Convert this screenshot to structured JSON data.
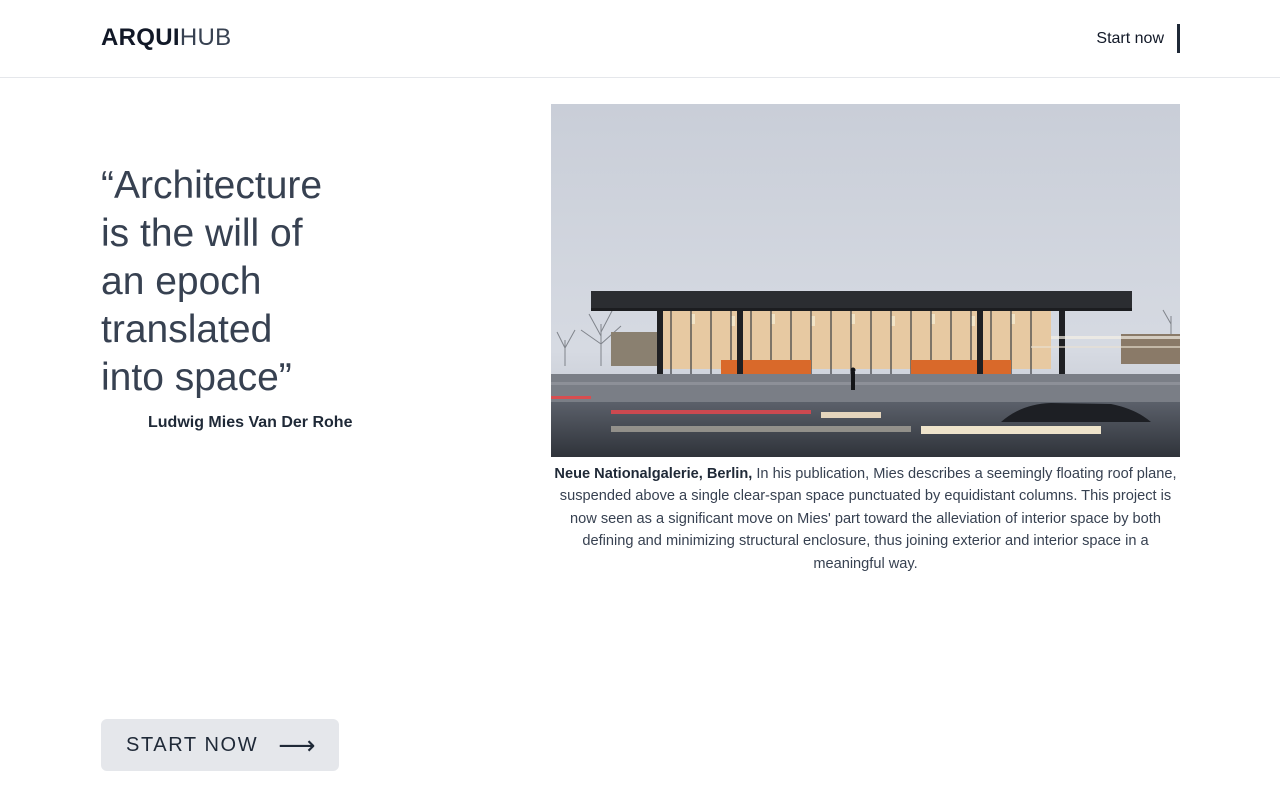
{
  "header": {
    "logo_bold": "ARQUI",
    "logo_light": "HUB",
    "start_label": "Start now"
  },
  "quote": {
    "lines": [
      "“Architecture",
      "is the will of",
      "an epoch",
      "translated",
      "into space”"
    ],
    "author": "Ludwig Mies Van Der Rohe"
  },
  "photo": {
    "subject": "Neue Nationalgalerie building at dusk with light trails"
  },
  "caption": {
    "title": "Neue Nationalgalerie, Berlin,",
    "body": " In his publication, Mies describes a seemingly floating roof plane, suspended above a single clear-span space punctuated by equidistant columns. This project is now seen as a significant move on Mies' part toward the alleviation of interior space by both defining and minimizing structural enclosure, thus joining exterior and interior space in a meaningful way."
  },
  "cta": {
    "label": "START NOW",
    "arrow_icon": "long-right-arrow-icon",
    "arrow_glyph": "⟶"
  },
  "colors": {
    "text": "#1f2937",
    "button_bg": "#e5e7eb",
    "divider": "#e5e7eb"
  }
}
